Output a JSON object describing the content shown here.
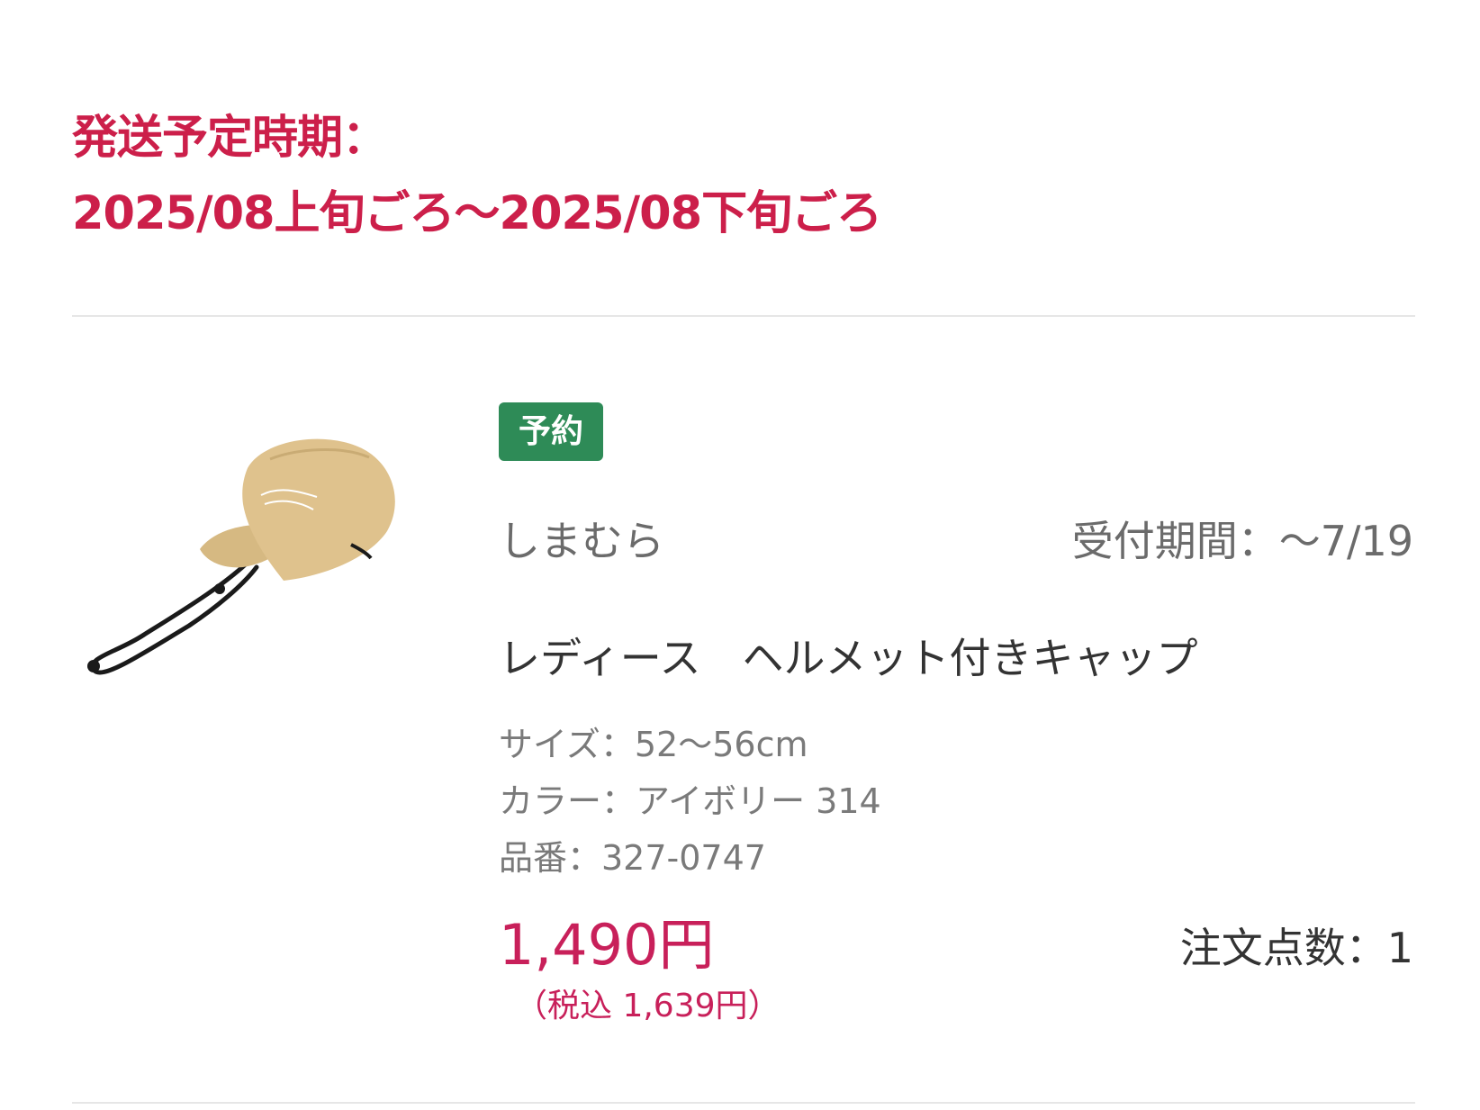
{
  "shipping": {
    "label": "発送予定時期：",
    "period": "2025/08上旬ごろ〜2025/08下旬ごろ"
  },
  "product": {
    "badge": "予約",
    "brand": "しまむら",
    "reception": "受付期間：〜7/19",
    "name": "レディース　ヘルメット付きキャップ",
    "size": "サイズ：52〜56cm",
    "color": "カラー：アイボリー 314",
    "item_number": "品番：327-0747",
    "price": "1,490円",
    "price_with_tax": "（税込 1,639円）",
    "quantity": "注文点数：1",
    "image_icon": "cap-image"
  },
  "colors": {
    "accent": "#cc1f4a",
    "badge": "#2e8b57",
    "price": "#c8205a"
  }
}
